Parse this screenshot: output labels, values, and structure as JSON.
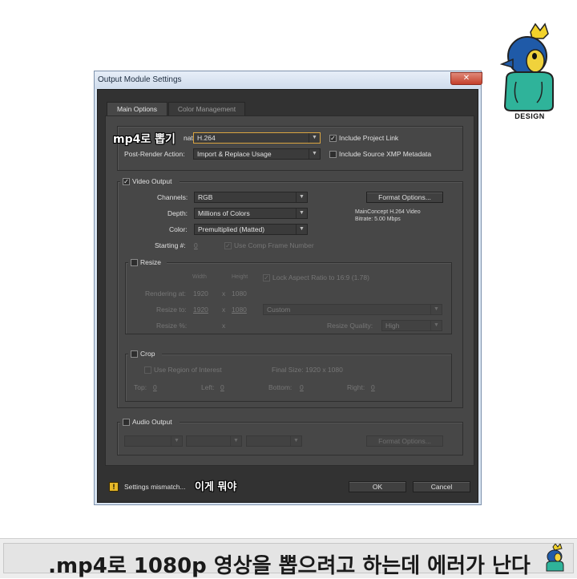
{
  "dialog": {
    "title": "Output Module Settings",
    "close_glyph": "✕",
    "tabs": [
      {
        "label": "Main Options",
        "active": true
      },
      {
        "label": "Color Management",
        "active": false
      }
    ],
    "format": {
      "label": "Format:",
      "label_visible": "nat:",
      "value": "H.264",
      "include_project_link": {
        "label": "Include Project Link",
        "checked": true
      },
      "post_render_label": "Post-Render Action:",
      "post_render_value": "Import & Replace Usage",
      "include_xmp": {
        "label": "Include Source XMP Metadata",
        "checked": false
      }
    },
    "video_output": {
      "label": "Video Output",
      "checked": true,
      "channels_label": "Channels:",
      "channels_value": "RGB",
      "depth_label": "Depth:",
      "depth_value": "Millions of Colors",
      "color_label": "Color:",
      "color_value": "Premultiplied (Matted)",
      "starting_label": "Starting #:",
      "starting_value": "0",
      "use_comp_frame_label": "Use Comp Frame Number",
      "format_options_label": "Format Options...",
      "codec_info": "MainConcept H.264 Video",
      "bitrate_info": "Bitrate: 5.00 Mbps"
    },
    "resize": {
      "label": "Resize",
      "width_header": "Width",
      "height_header": "Height",
      "lock_aspect_label": "Lock Aspect Ratio to 16:9 (1.78)",
      "rendering_at_label": "Rendering at:",
      "rendering_w": "1920",
      "rendering_h": "1080",
      "times": "x",
      "resize_to_label": "Resize to:",
      "resize_to_w": "1920",
      "resize_to_h": "1080",
      "preset_value": "Custom",
      "resize_pct_label": "Resize %:",
      "quality_label": "Resize Quality:",
      "quality_value": "High"
    },
    "crop": {
      "label": "Crop",
      "use_roi_label": "Use Region of Interest",
      "final_size": "Final Size: 1920 x 1080",
      "top_label": "Top:",
      "top_value": "0",
      "left_label": "Left:",
      "left_value": "0",
      "bottom_label": "Bottom:",
      "bottom_value": "0",
      "right_label": "Right:",
      "right_value": "0"
    },
    "audio_output": {
      "label": "Audio Output",
      "checked": false,
      "format_options_label": "Format Options..."
    },
    "footer": {
      "warning_glyph": "!",
      "warning_text": "Settings mismatch...",
      "ok_label": "OK",
      "cancel_label": "Cancel"
    }
  },
  "annotations": {
    "format_callout": "mp4로 뽑기",
    "warning_callout": "이게 뭐야"
  },
  "mascot": {
    "badge": "DESIGN"
  },
  "caption": {
    "text": ".mp4로 1080p 영상을 뽑으려고 하는데 에러가 난다"
  },
  "colors": {
    "dialog_bg": "#474747",
    "accent_highlight": "#d9a441",
    "warning": "#e7b829",
    "mascot_body": "#2fb39a",
    "mascot_head": "#1f5aa8",
    "mascot_crown": "#f2d22a"
  }
}
